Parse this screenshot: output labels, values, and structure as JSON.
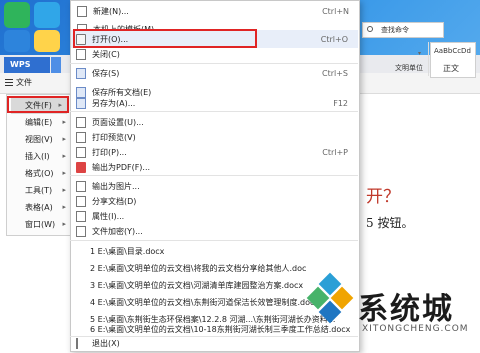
{
  "wps": {
    "app_name": "WPS",
    "file_menu_label": "文件",
    "user_label": "文明单位",
    "search_label": "查找命令",
    "style_sample": "AaBbCcDd",
    "style_name": "正文",
    "doc_heading_fragment": "开？",
    "doc_body_fragment": "5 按钮。"
  },
  "left_menu": {
    "items": [
      {
        "label": "文件(F)",
        "arrow": "▸",
        "active": true
      },
      {
        "label": "编辑(E)",
        "arrow": "▸"
      },
      {
        "label": "视图(V)",
        "arrow": "▸"
      },
      {
        "label": "插入(I)",
        "arrow": "▸"
      },
      {
        "label": "格式(O)",
        "arrow": "▸"
      },
      {
        "label": "工具(T)",
        "arrow": "▸"
      },
      {
        "label": "表格(A)",
        "arrow": "▸"
      },
      {
        "label": "窗口(W)",
        "arrow": "▸"
      }
    ]
  },
  "dropdown": {
    "items": [
      {
        "label": "新建(N)...",
        "shortcut": "Ctrl+N",
        "icon": "new-doc-icon"
      },
      {
        "label": "本机上的模板(M)...",
        "shortcut": "",
        "icon": "template-icon"
      },
      {
        "label": "打开(O)...",
        "shortcut": "Ctrl+O",
        "icon": "open-folder-icon"
      },
      {
        "label": "关闭(C)",
        "shortcut": "",
        "icon": "close-doc-icon"
      },
      {
        "label": "保存(S)",
        "shortcut": "Ctrl+S",
        "icon": "save-icon"
      },
      {
        "label": "保存所有文档(E)",
        "shortcut": "",
        "icon": "save-all-icon"
      },
      {
        "label": "另存为(A)...",
        "shortcut": "F12",
        "icon": "save-as-icon"
      },
      {
        "label": "页面设置(U)...",
        "shortcut": "",
        "icon": "page-setup-icon"
      },
      {
        "label": "打印预览(V)",
        "shortcut": "",
        "icon": "print-preview-icon"
      },
      {
        "label": "打印(P)...",
        "shortcut": "Ctrl+P",
        "icon": "print-icon"
      },
      {
        "label": "输出为PDF(F)...",
        "shortcut": "",
        "icon": "pdf-icon"
      },
      {
        "label": "输出为图片...",
        "shortcut": "",
        "icon": "export-image-icon"
      },
      {
        "label": "分享文档(D)",
        "shortcut": "",
        "icon": "share-icon"
      },
      {
        "label": "属性(I)...",
        "shortcut": "",
        "icon": "properties-icon"
      },
      {
        "label": "文件加密(Y)...",
        "shortcut": "",
        "icon": "encrypt-icon"
      }
    ],
    "recent": [
      "1 E:\\桌面\\目录.docx",
      "2 E:\\桌面\\文明单位的云文档\\将我的云文档分享给其他人.doc",
      "3 E:\\桌面\\文明单位的云文档\\河湖清单库建园整治方案.docx",
      "4 E:\\桌面\\文明单位的云文档\\东荆街河道保洁长效管理制度.docx",
      "5 E:\\桌面\\东荆街生态环保档案\\12.2.8 河湖...\\东荆街河湖长办资料...",
      "6 E:\\桌面\\文明单位的云文档\\10-18东荆街河湖长制三季度工作总结.docx"
    ],
    "exit_label": "退出(X)"
  },
  "watermark": {
    "brand": "系统城",
    "domain": "XITONGCHENG.COM"
  }
}
